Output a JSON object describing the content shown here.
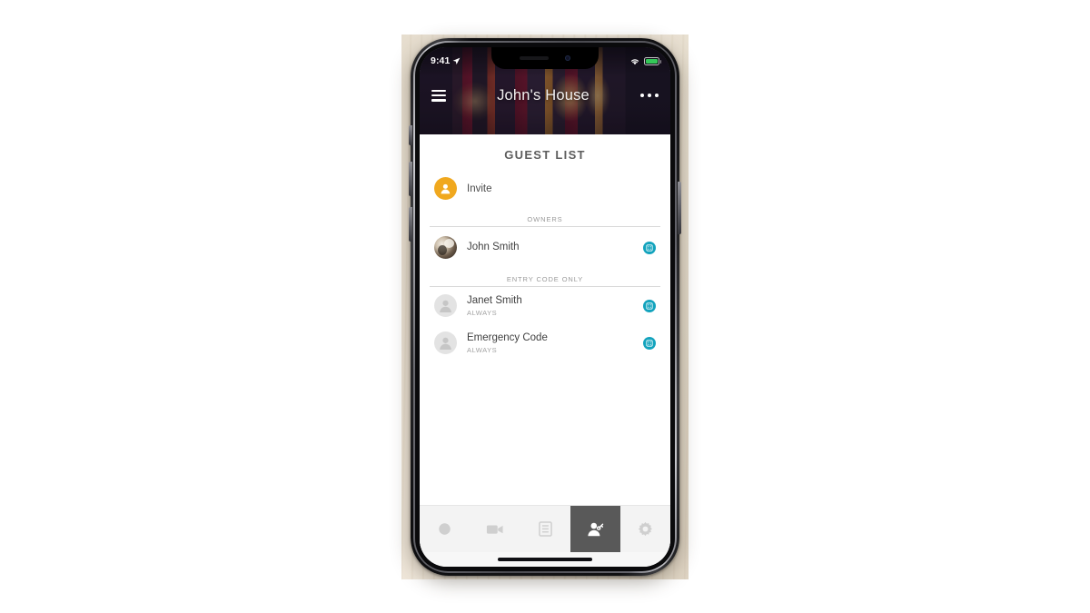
{
  "status_bar": {
    "time": "9:41",
    "location_icon": "location-arrow-icon",
    "wifi_icon": "wifi-icon",
    "battery_icon": "battery-icon",
    "battery_level_pct": 84
  },
  "nav": {
    "menu_icon": "hamburger-menu-icon",
    "title": "John's House",
    "more_icon": "more-options-icon"
  },
  "page": {
    "title": "GUEST LIST"
  },
  "invite": {
    "label": "Invite",
    "icon": "add-person-icon",
    "accent_color": "#f0a81e"
  },
  "sections": [
    {
      "label": "OWNERS",
      "people": [
        {
          "name": "John Smith",
          "subtitle": "",
          "avatar_type": "photo",
          "badge_icon": "entry-code-icon",
          "badge_color": "#13a3bd"
        }
      ]
    },
    {
      "label": "ENTRY CODE ONLY",
      "people": [
        {
          "name": "Janet Smith",
          "subtitle": "ALWAYS",
          "avatar_type": "placeholder",
          "badge_icon": "entry-code-icon",
          "badge_color": "#13a3bd"
        },
        {
          "name": "Emergency Code",
          "subtitle": "ALWAYS",
          "avatar_type": "placeholder",
          "badge_icon": "entry-code-icon",
          "badge_color": "#13a3bd"
        }
      ]
    }
  ],
  "tabbar": {
    "active_index": 3,
    "active_bg": "#595959",
    "tabs": [
      {
        "icon": "record-circle-icon",
        "active": false
      },
      {
        "icon": "video-camera-icon",
        "active": false
      },
      {
        "icon": "event-log-icon",
        "active": false
      },
      {
        "icon": "guests-person-key-icon",
        "active": true
      },
      {
        "icon": "settings-gear-icon",
        "active": false
      }
    ]
  }
}
